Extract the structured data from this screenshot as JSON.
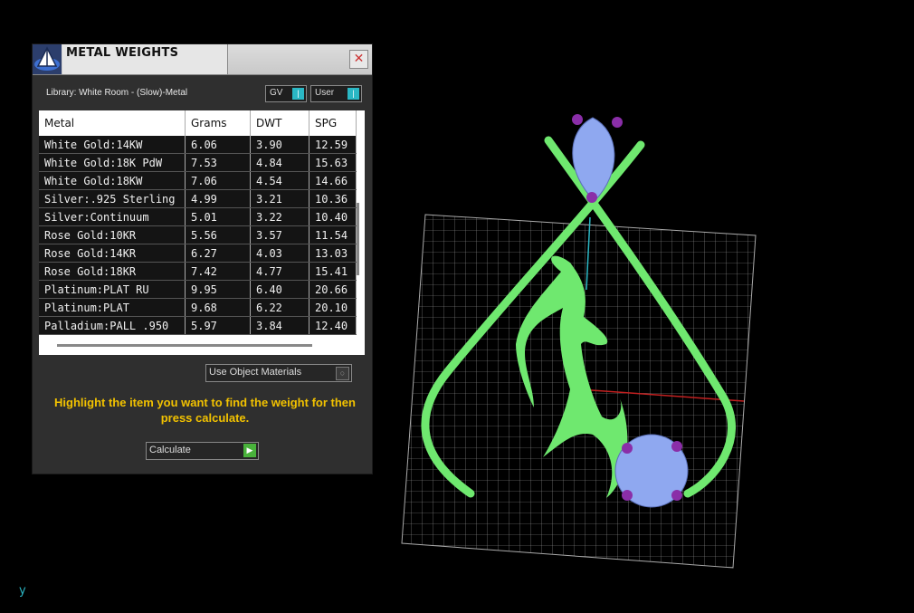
{
  "window": {
    "title": "METAL WEIGHTS",
    "close_glyph": "✕",
    "library_label": "Library: White Room - (Slow)-Metal",
    "gv_label": "GV",
    "user_label": "User",
    "use_object_materials": "Use Object Materials",
    "hint": "Highlight the item you want to find the weight for then press calculate.",
    "calculate": "Calculate"
  },
  "table": {
    "headers": [
      "Metal",
      "Grams",
      "DWT",
      "SPG"
    ],
    "rows": [
      [
        "White Gold:14KW",
        "6.06",
        "3.90",
        "12.59"
      ],
      [
        "White Gold:18K PdW",
        "7.53",
        "4.84",
        "15.63"
      ],
      [
        "White Gold:18KW",
        "7.06",
        "4.54",
        "14.66"
      ],
      [
        "Silver:.925 Sterling",
        "4.99",
        "3.21",
        "10.36"
      ],
      [
        "Silver:Continuum",
        "5.01",
        "3.22",
        "10.40"
      ],
      [
        "Rose Gold:10KR",
        "5.56",
        "3.57",
        "11.54"
      ],
      [
        "Rose Gold:14KR",
        "6.27",
        "4.03",
        "13.03"
      ],
      [
        "Rose Gold:18KR",
        "7.42",
        "4.77",
        "15.41"
      ],
      [
        "Platinum:PLAT RU",
        "9.95",
        "6.40",
        "20.66"
      ],
      [
        "Platinum:PLAT",
        "9.68",
        "6.22",
        "20.10"
      ],
      [
        "Palladium:PALL .950",
        "5.97",
        "3.84",
        "12.40"
      ]
    ]
  },
  "viewport": {
    "axis_label": "y",
    "colors": {
      "background": "#000000",
      "grid": "#9a9a9a",
      "metal": "#6fe86f",
      "gem": "#8fa8f0",
      "prong": "#8a2ea8",
      "axis_x": "#c22020",
      "axis_y": "#2bb7c4"
    }
  }
}
